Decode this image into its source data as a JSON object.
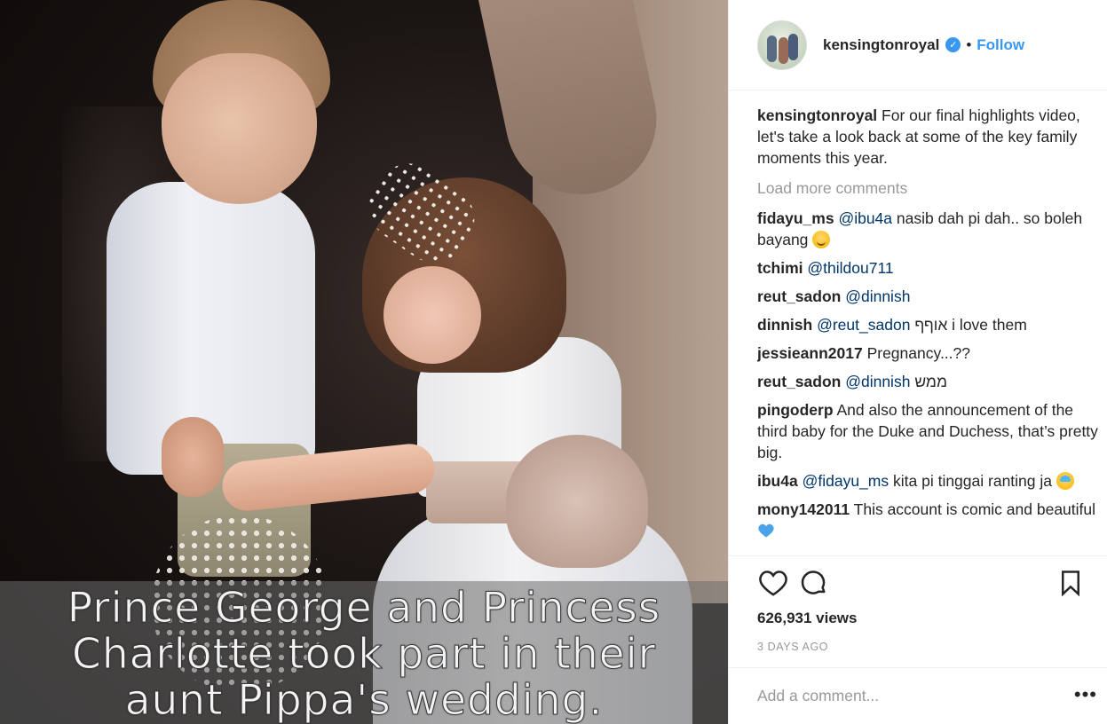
{
  "media": {
    "overlay_caption_lines": [
      "Prince George and Princess",
      "Charlotte took part in their",
      "aunt Pippa's wedding."
    ]
  },
  "header": {
    "username": "kensingtonroyal",
    "verified_icon": "verified-badge-icon",
    "separator": "•",
    "follow_label": "Follow"
  },
  "caption": {
    "username": "kensingtonroyal",
    "text": "For our final highlights video, let's take a look back at some of the key family moments this year."
  },
  "load_more_label": "Load more comments",
  "comments": [
    {
      "user": "fidayu_ms",
      "mention": "@ibu4a",
      "text": "nasib dah pi dah.. so boleh bayang",
      "emoji": "smiling-face-emoji"
    },
    {
      "user": "tchimi",
      "mention": "@thildou711",
      "text": ""
    },
    {
      "user": "reut_sadon",
      "mention": "@dinnish",
      "text": ""
    },
    {
      "user": "dinnish",
      "mention": "@reut_sadon",
      "text": "אוףף i love them"
    },
    {
      "user": "jessieann2017",
      "mention": "",
      "text": "Pregnancy...??"
    },
    {
      "user": "reut_sadon",
      "mention": "@dinnish",
      "text": "ממש"
    },
    {
      "user": "pingoderp",
      "mention": "",
      "text": "And also the announcement of the third baby for the Duke and Duchess, that’s pretty big."
    },
    {
      "user": "ibu4a",
      "mention": "@fidayu_ms",
      "text": "kita pi tinggai ranting ja",
      "emoji": "sweat-smile-emoji"
    },
    {
      "user": "mony142011",
      "mention": "",
      "text": "This account is comic and beautiful",
      "emoji": "blue-heart-emoji"
    }
  ],
  "actions": {
    "like_icon": "heart-icon",
    "comment_icon": "comment-icon",
    "save_icon": "bookmark-icon",
    "views": "626,931 views",
    "timestamp": "3 DAYS AGO"
  },
  "add_comment": {
    "placeholder": "Add a comment...",
    "more_icon": "more-options-icon",
    "more_label": "•••"
  },
  "colors": {
    "accent": "#3897f0",
    "mention": "#003569",
    "muted": "#999999",
    "text": "#262626"
  }
}
